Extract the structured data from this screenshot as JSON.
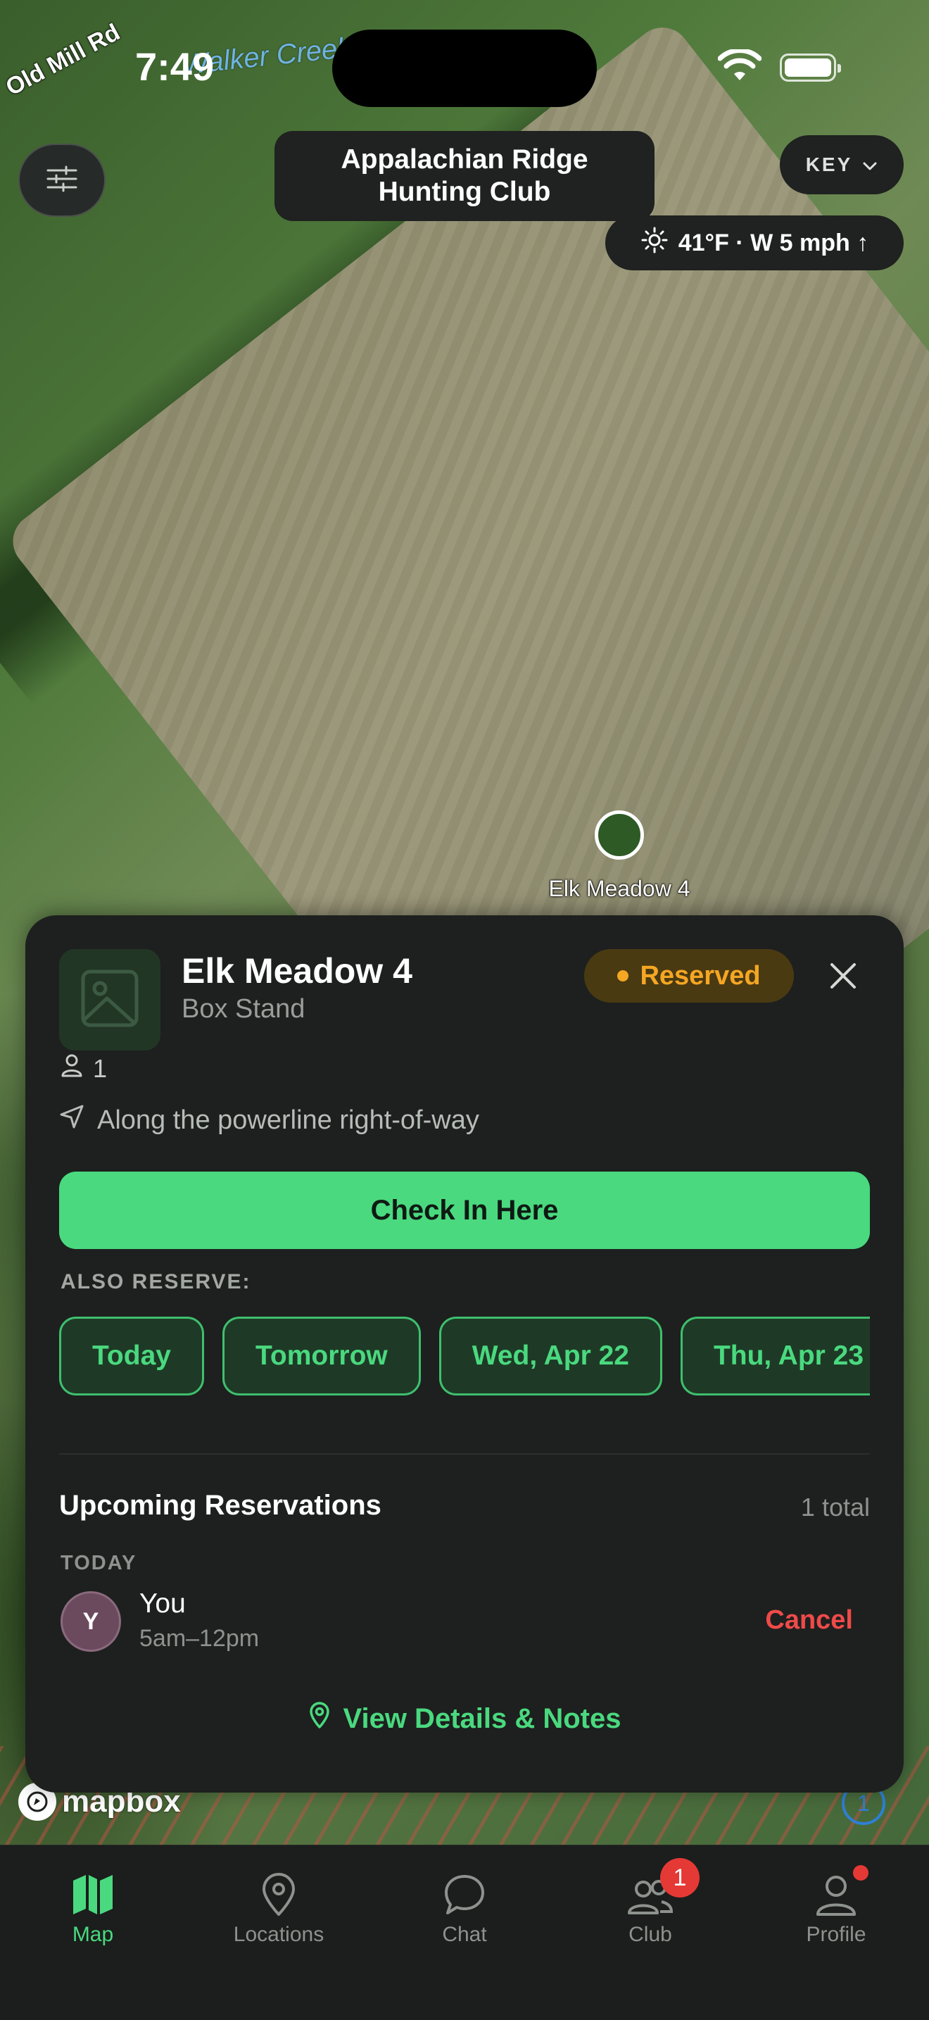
{
  "status_bar": {
    "time": "7:49"
  },
  "map": {
    "road_label": "Old Mill Rd",
    "creek_label": "Walker Creek",
    "stand_marker_label": "Elk Meadow 4",
    "attribution": "mapbox",
    "compass_value": "1"
  },
  "header": {
    "club_name": "Appalachian Ridge Hunting Club",
    "key_label": "KEY",
    "weather": "41°F · W 5 mph ↑"
  },
  "stand_sheet": {
    "name": "Elk Meadow 4",
    "type": "Box Stand",
    "status": "Reserved",
    "status_color": "#f5a623",
    "capacity": "1",
    "location_note": "Along the powerline right-of-way",
    "checkin_label": "Check In Here",
    "also_reserve_label": "ALSO RESERVE:",
    "reserve_days": [
      "Today",
      "Tomorrow",
      "Wed, Apr 22",
      "Thu, Apr 23"
    ],
    "upcoming": {
      "title": "Upcoming Reservations",
      "count": "1 total",
      "groups": [
        {
          "day": "TODAY",
          "items": [
            {
              "initial": "Y",
              "name": "You",
              "time": "5am–12pm",
              "action": "Cancel"
            }
          ]
        }
      ]
    },
    "details_link": "View Details & Notes"
  },
  "tabs": [
    {
      "label": "Map",
      "icon": "map-icon",
      "active": true
    },
    {
      "label": "Locations",
      "icon": "location-pin-icon"
    },
    {
      "label": "Chat",
      "icon": "chat-bubble-icon"
    },
    {
      "label": "Club",
      "icon": "people-icon",
      "badge": "1"
    },
    {
      "label": "Profile",
      "icon": "person-icon",
      "dot": true
    }
  ],
  "colors": {
    "accent": "#4ad97f",
    "sheet_bg": "#1d201e",
    "danger": "#ef4a4a"
  }
}
